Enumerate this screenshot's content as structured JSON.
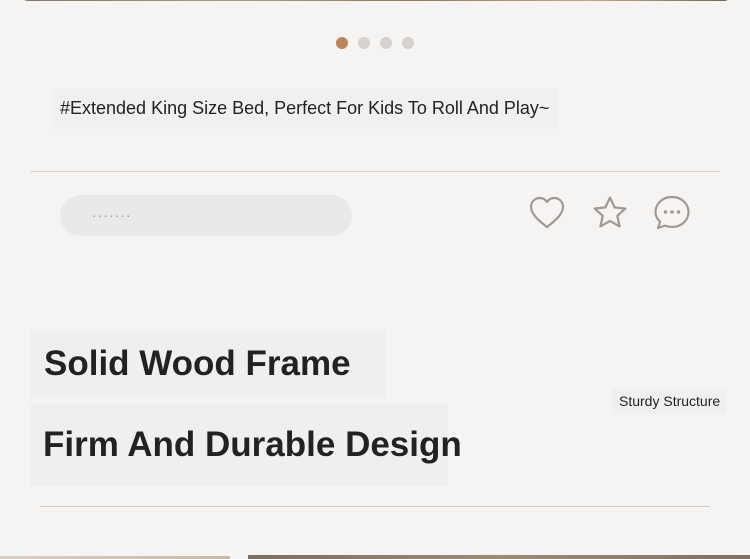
{
  "hero": {
    "slide_count": 4,
    "active_slide_index": 0,
    "active_color": "#b8875b",
    "inactive_color": "#d4d1cf"
  },
  "post": {
    "hashtag": "#Extended King Size Bed, Perfect For Kids To Roll And Play~"
  },
  "interaction": {
    "comment_placeholder": "·······",
    "icons": [
      "heart-icon",
      "star-icon",
      "chat-icon"
    ]
  },
  "feature": {
    "title_line_1": "Solid Wood Frame",
    "title_line_2": "Firm And Durable Design",
    "subtitle": "Sturdy Structure"
  }
}
